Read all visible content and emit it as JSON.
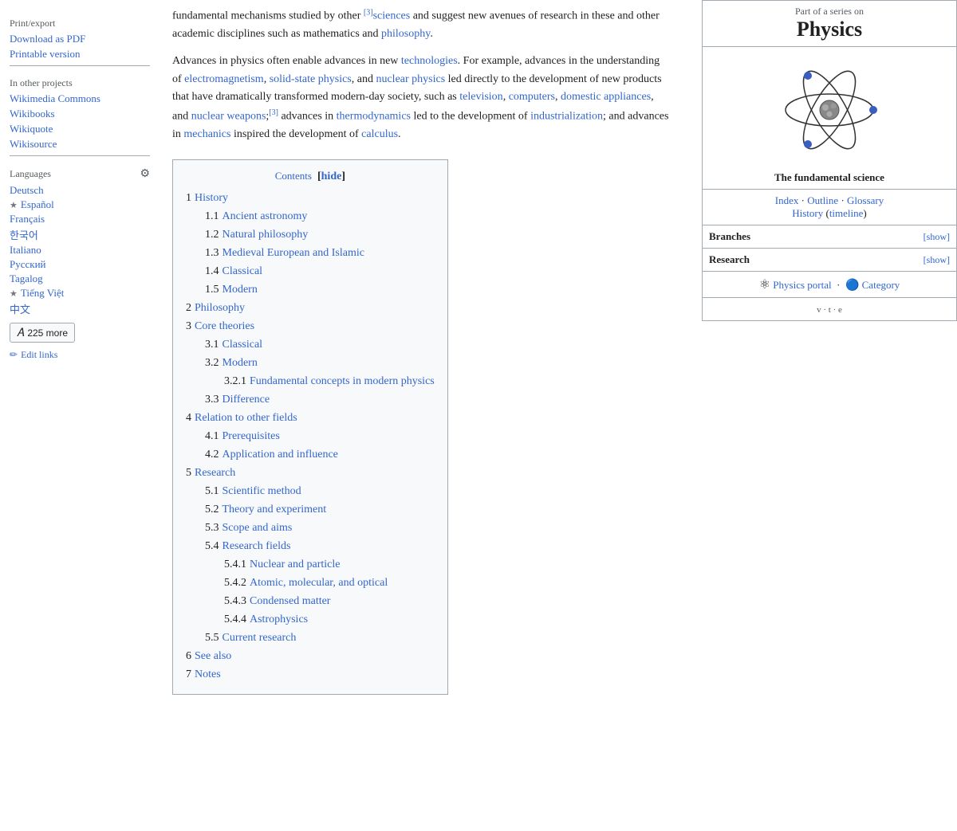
{
  "sidebar": {
    "print_export_label": "Print/export",
    "download_pdf": "Download as PDF",
    "printable_version": "Printable version",
    "other_projects_label": "In other projects",
    "wikimedia_commons": "Wikimedia Commons",
    "wikibooks": "Wikibooks",
    "wikiquote": "Wikiquote",
    "wikisource": "Wikisource",
    "languages_label": "Languages",
    "langs": [
      {
        "name": "Deutsch",
        "starred": false
      },
      {
        "name": "Español",
        "starred": true
      },
      {
        "name": "Français",
        "starred": false
      },
      {
        "name": "한국어",
        "starred": false
      },
      {
        "name": "Italiano",
        "starred": false
      },
      {
        "name": "Русский",
        "starred": false
      },
      {
        "name": "Tagalog",
        "starred": false
      },
      {
        "name": "Tiếng Việt",
        "starred": true
      },
      {
        "name": "中文",
        "starred": false
      }
    ],
    "more_languages": "225 more",
    "edit_links": "Edit links"
  },
  "main": {
    "body_text_1": "fundamental mechanisms studied by other",
    "sciences_link": "sciences",
    "body_text_1b": "and suggest new avenues of research in these and other academic disciplines such as mathematics and",
    "philosophy_link": "philosophy",
    "body_text_2": "Advances in physics often enable advances in new",
    "technologies_link": "technologies",
    "body_text_2b": ". For example, advances in the understanding of",
    "electromagnetism_link": "electromagnetism",
    "solid_state_link": "solid-state physics",
    "body_text_2c": "and",
    "nuclear_physics_link": "nuclear physics",
    "body_text_2d": "led directly to the development of new products that have dramatically transformed modern-day society, such as",
    "television_link": "television",
    "computers_link": "computers",
    "domestic_link": "domestic appliances",
    "nuclear_weapons_link": "nuclear weapons",
    "body_text_2e": "advances in",
    "thermodynamics_link": "thermodynamics",
    "body_text_2f": "led to the development of",
    "industrialization_link": "industrialization",
    "body_text_2g": "and advances in",
    "mechanics_link": "mechanics",
    "body_text_2h": "inspired the development of",
    "calculus_link": "calculus",
    "toc": {
      "title": "Contents",
      "hide_label": "hide",
      "items": [
        {
          "num": "1",
          "label": "History",
          "level": 1
        },
        {
          "num": "1.1",
          "label": "Ancient astronomy",
          "level": 2
        },
        {
          "num": "1.2",
          "label": "Natural philosophy",
          "level": 2
        },
        {
          "num": "1.3",
          "label": "Medieval European and Islamic",
          "level": 2
        },
        {
          "num": "1.4",
          "label": "Classical",
          "level": 2
        },
        {
          "num": "1.5",
          "label": "Modern",
          "level": 2
        },
        {
          "num": "2",
          "label": "Philosophy",
          "level": 1
        },
        {
          "num": "3",
          "label": "Core theories",
          "level": 1
        },
        {
          "num": "3.1",
          "label": "Classical",
          "level": 2
        },
        {
          "num": "3.2",
          "label": "Modern",
          "level": 2
        },
        {
          "num": "3.2.1",
          "label": "Fundamental concepts in modern physics",
          "level": 3
        },
        {
          "num": "3.3",
          "label": "Difference",
          "level": 2
        },
        {
          "num": "4",
          "label": "Relation to other fields",
          "level": 1
        },
        {
          "num": "4.1",
          "label": "Prerequisites",
          "level": 2
        },
        {
          "num": "4.2",
          "label": "Application and influence",
          "level": 2
        },
        {
          "num": "5",
          "label": "Research",
          "level": 1
        },
        {
          "num": "5.1",
          "label": "Scientific method",
          "level": 2
        },
        {
          "num": "5.2",
          "label": "Theory and experiment",
          "level": 2
        },
        {
          "num": "5.3",
          "label": "Scope and aims",
          "level": 2
        },
        {
          "num": "5.4",
          "label": "Research fields",
          "level": 2
        },
        {
          "num": "5.4.1",
          "label": "Nuclear and particle",
          "level": 3
        },
        {
          "num": "5.4.2",
          "label": "Atomic, molecular, and optical",
          "level": 3
        },
        {
          "num": "5.4.3",
          "label": "Condensed matter",
          "level": 3
        },
        {
          "num": "5.4.4",
          "label": "Astrophysics",
          "level": 3
        },
        {
          "num": "5.5",
          "label": "Current research",
          "level": 2
        },
        {
          "num": "6",
          "label": "See also",
          "level": 1
        },
        {
          "num": "7",
          "label": "Notes",
          "level": 1
        }
      ]
    }
  },
  "infobox": {
    "series_label": "Part of a series on",
    "title": "Physics",
    "subtitle": "The fundamental science",
    "links": {
      "index": "Index",
      "outline": "Outline",
      "glossary": "Glossary",
      "history": "History",
      "timeline": "timeline"
    },
    "branches_label": "Branches",
    "branches_show": "[show]",
    "research_label": "Research",
    "research_show": "[show]",
    "portal_label": "Physics portal",
    "category_label": "Category",
    "vte": "v · t · e"
  }
}
